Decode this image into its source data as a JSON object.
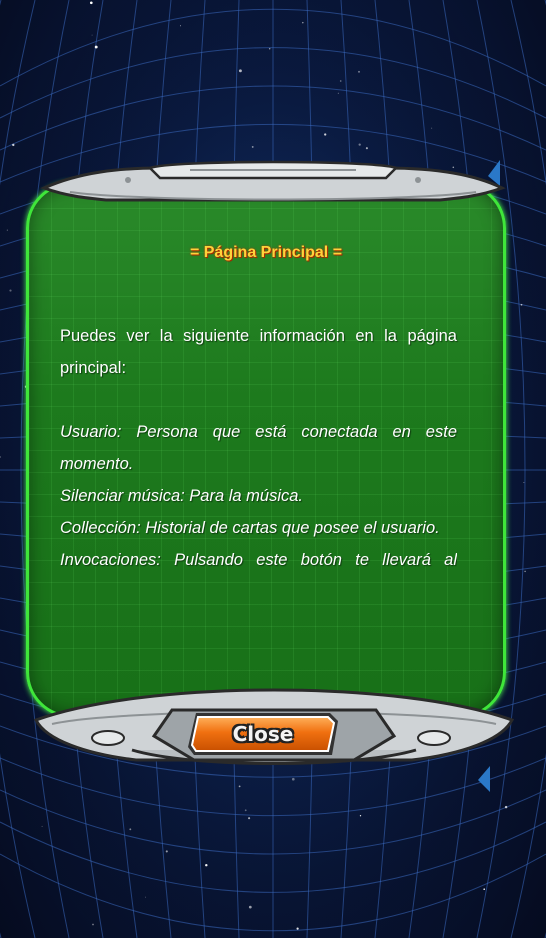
{
  "dialog": {
    "title": "= Página Principal =",
    "paragraphs": {
      "intro": "Puedes ver la siguiente información en la página principal:",
      "usuario": "Usuario: Persona que está conectada en este momento.",
      "silenciar": "Silenciar música: Para la música.",
      "coleccion": "Collección: Historial de cartas que posee el usuario.",
      "invocaciones": "Invocaciones: Pulsando este botón te llevará al"
    },
    "close_label": "Close"
  },
  "colors": {
    "panel_green": "#1d7a1d",
    "panel_border": "#3fe63a",
    "title_yellow": "#ffd23a",
    "button_orange": "#f07010",
    "background_navy": "#0a1a42",
    "grid_blue": "#2a5aa8"
  },
  "icons": [
    "blue-triangle-marker-icon"
  ]
}
